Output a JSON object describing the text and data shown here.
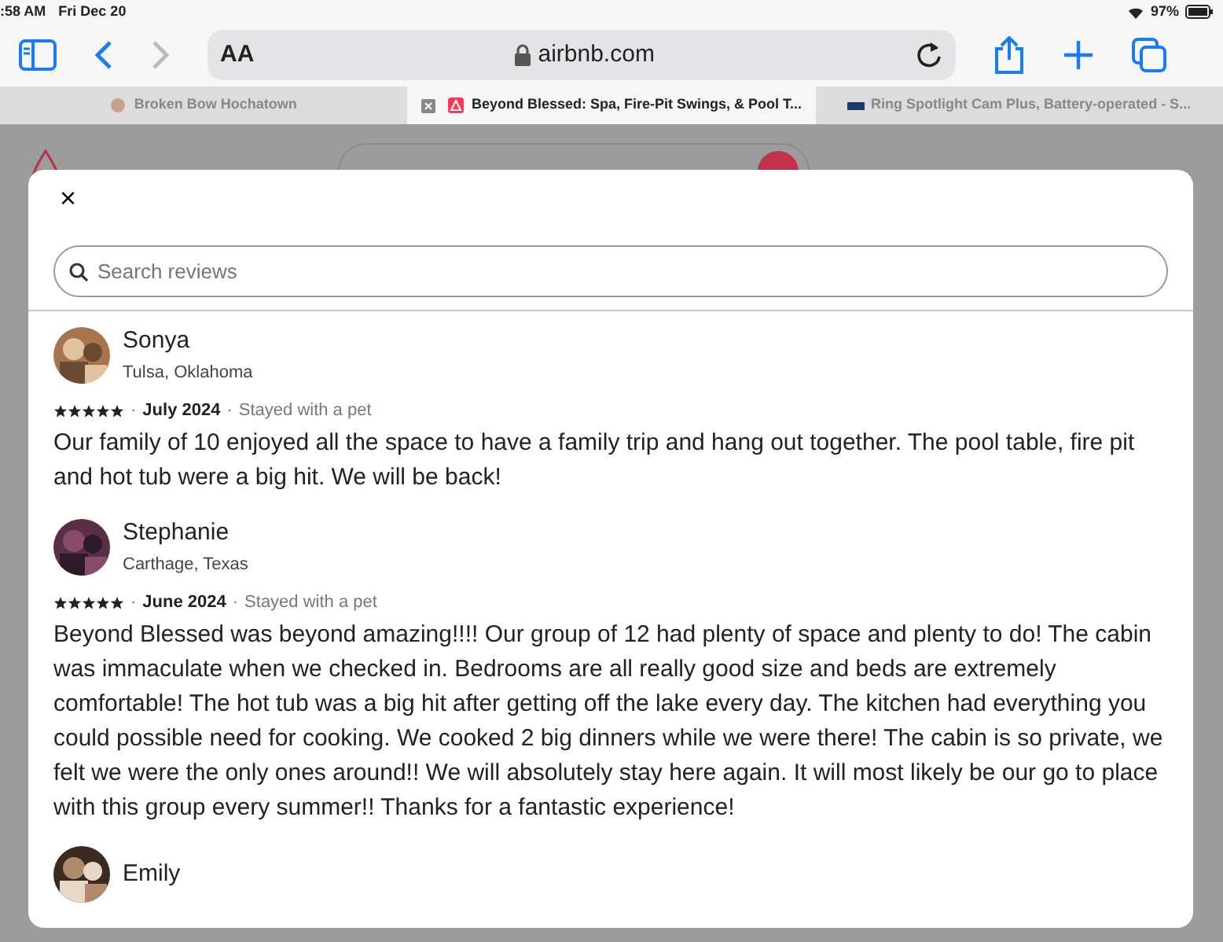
{
  "status_bar": {
    "time": ":58 AM",
    "date": "Fri Dec 20",
    "battery": "97%"
  },
  "toolbar": {
    "text_size": "AA",
    "address": "airbnb.com"
  },
  "tabs": [
    {
      "label": "Broken Bow Hochatown",
      "selected": false
    },
    {
      "label": "Beyond Blessed: Spa, Fire-Pit Swings, & Pool T...",
      "selected": true
    },
    {
      "label": "Ring Spotlight Cam Plus, Battery-operated - S...",
      "selected": false
    }
  ],
  "reviews_dialog": {
    "close": "×",
    "search": {
      "placeholder": "Search reviews"
    },
    "reviews": [
      {
        "name": "Sonya",
        "location": "Tulsa, Oklahoma",
        "stars": 5,
        "separators": [
          "·",
          "·"
        ],
        "date": "July 2024",
        "note": "Stayed with a pet",
        "text": "Our family of 10 enjoyed all the space to have a family trip and hang out together. The pool table, fire pit and hot tub were a big hit. We will be back!"
      },
      {
        "name": "Stephanie",
        "location": "Carthage, Texas",
        "stars": 5,
        "separators": [
          "·",
          "·"
        ],
        "date": "June 2024",
        "note": "Stayed with a pet",
        "text": "Beyond Blessed was beyond amazing!!!! Our group of 12 had plenty of space and plenty to do! The cabin was immaculate when we checked in. Bedrooms are all really good size and beds are extremely comfortable! The hot tub was a big hit after getting off the lake every day. The kitchen had everything you could possible need for cooking. We cooked 2 big dinners while we were there! The cabin is so private, we felt we were the only ones around!! We will absolutely stay here again. It will most likely be our go to place with this group every summer!! Thanks for a fantastic experience!"
      },
      {
        "name": "Emily"
      }
    ]
  }
}
